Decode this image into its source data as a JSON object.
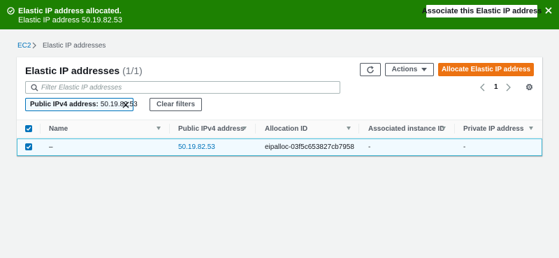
{
  "flash": {
    "title": "Elastic IP address allocated.",
    "message": "Elastic IP address 50.19.82.53",
    "action_label": "Associate this Elastic IP address",
    "color": "#1d8102"
  },
  "breadcrumb": {
    "root": "EC2",
    "current": "Elastic IP addresses"
  },
  "panel": {
    "title": "Elastic IP addresses",
    "count": "(1/1)",
    "actions_label": "Actions",
    "primary_label": "Allocate Elastic IP address",
    "primary_color": "#ec7211"
  },
  "search": {
    "placeholder": "Filter Elastic IP addresses",
    "value": ""
  },
  "pagination": {
    "current_page": "1"
  },
  "filter_token": {
    "key": "Public IPv4 address:",
    "value": "50.19.82.53"
  },
  "clear_filters_label": "Clear filters",
  "table": {
    "columns": [
      "Name",
      "Public IPv4 address",
      "Allocation ID",
      "Associated instance ID",
      "Private IP address"
    ],
    "rows": [
      {
        "selected": true,
        "name": "–",
        "public_ip": "50.19.82.53",
        "allocation_id": "eipalloc-03f5c653827cb7958",
        "instance_id": "-",
        "private_ip": "-"
      }
    ]
  },
  "icons": {
    "flash_status": "check-circle-icon",
    "flash_close": "close-icon",
    "breadcrumb_separator": "chevron-right-icon",
    "refresh": "refresh-icon",
    "actions_caret": "caret-down-icon",
    "search": "search-icon",
    "pager_prev": "chevron-left-icon",
    "pager_next": "chevron-right-icon",
    "settings": "gear-icon",
    "token_remove": "close-icon",
    "sort": "caret-down-icon",
    "checkbox": "checkbox-checked-icon"
  }
}
